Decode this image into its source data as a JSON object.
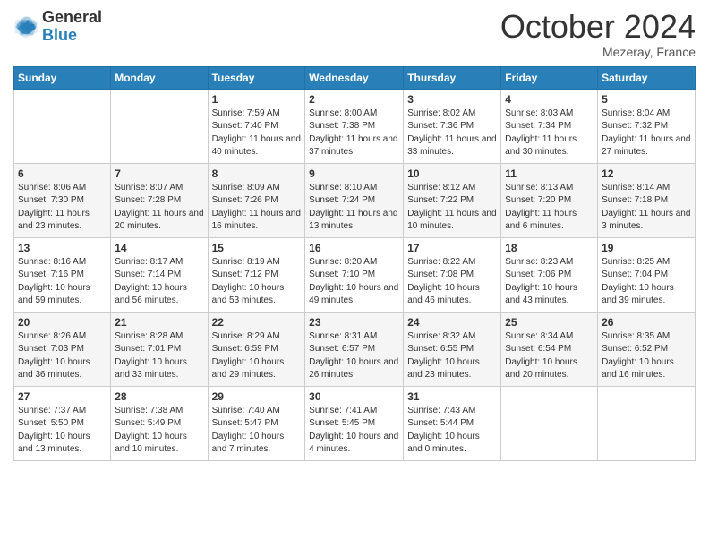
{
  "header": {
    "logo_general": "General",
    "logo_blue": "Blue",
    "month": "October 2024",
    "location": "Mezeray, France"
  },
  "days_of_week": [
    "Sunday",
    "Monday",
    "Tuesday",
    "Wednesday",
    "Thursday",
    "Friday",
    "Saturday"
  ],
  "weeks": [
    [
      {
        "day": "",
        "info": ""
      },
      {
        "day": "",
        "info": ""
      },
      {
        "day": "1",
        "info": "Sunrise: 7:59 AM\nSunset: 7:40 PM\nDaylight: 11 hours and 40 minutes."
      },
      {
        "day": "2",
        "info": "Sunrise: 8:00 AM\nSunset: 7:38 PM\nDaylight: 11 hours and 37 minutes."
      },
      {
        "day": "3",
        "info": "Sunrise: 8:02 AM\nSunset: 7:36 PM\nDaylight: 11 hours and 33 minutes."
      },
      {
        "day": "4",
        "info": "Sunrise: 8:03 AM\nSunset: 7:34 PM\nDaylight: 11 hours and 30 minutes."
      },
      {
        "day": "5",
        "info": "Sunrise: 8:04 AM\nSunset: 7:32 PM\nDaylight: 11 hours and 27 minutes."
      }
    ],
    [
      {
        "day": "6",
        "info": "Sunrise: 8:06 AM\nSunset: 7:30 PM\nDaylight: 11 hours and 23 minutes."
      },
      {
        "day": "7",
        "info": "Sunrise: 8:07 AM\nSunset: 7:28 PM\nDaylight: 11 hours and 20 minutes."
      },
      {
        "day": "8",
        "info": "Sunrise: 8:09 AM\nSunset: 7:26 PM\nDaylight: 11 hours and 16 minutes."
      },
      {
        "day": "9",
        "info": "Sunrise: 8:10 AM\nSunset: 7:24 PM\nDaylight: 11 hours and 13 minutes."
      },
      {
        "day": "10",
        "info": "Sunrise: 8:12 AM\nSunset: 7:22 PM\nDaylight: 11 hours and 10 minutes."
      },
      {
        "day": "11",
        "info": "Sunrise: 8:13 AM\nSunset: 7:20 PM\nDaylight: 11 hours and 6 minutes."
      },
      {
        "day": "12",
        "info": "Sunrise: 8:14 AM\nSunset: 7:18 PM\nDaylight: 11 hours and 3 minutes."
      }
    ],
    [
      {
        "day": "13",
        "info": "Sunrise: 8:16 AM\nSunset: 7:16 PM\nDaylight: 10 hours and 59 minutes."
      },
      {
        "day": "14",
        "info": "Sunrise: 8:17 AM\nSunset: 7:14 PM\nDaylight: 10 hours and 56 minutes."
      },
      {
        "day": "15",
        "info": "Sunrise: 8:19 AM\nSunset: 7:12 PM\nDaylight: 10 hours and 53 minutes."
      },
      {
        "day": "16",
        "info": "Sunrise: 8:20 AM\nSunset: 7:10 PM\nDaylight: 10 hours and 49 minutes."
      },
      {
        "day": "17",
        "info": "Sunrise: 8:22 AM\nSunset: 7:08 PM\nDaylight: 10 hours and 46 minutes."
      },
      {
        "day": "18",
        "info": "Sunrise: 8:23 AM\nSunset: 7:06 PM\nDaylight: 10 hours and 43 minutes."
      },
      {
        "day": "19",
        "info": "Sunrise: 8:25 AM\nSunset: 7:04 PM\nDaylight: 10 hours and 39 minutes."
      }
    ],
    [
      {
        "day": "20",
        "info": "Sunrise: 8:26 AM\nSunset: 7:03 PM\nDaylight: 10 hours and 36 minutes."
      },
      {
        "day": "21",
        "info": "Sunrise: 8:28 AM\nSunset: 7:01 PM\nDaylight: 10 hours and 33 minutes."
      },
      {
        "day": "22",
        "info": "Sunrise: 8:29 AM\nSunset: 6:59 PM\nDaylight: 10 hours and 29 minutes."
      },
      {
        "day": "23",
        "info": "Sunrise: 8:31 AM\nSunset: 6:57 PM\nDaylight: 10 hours and 26 minutes."
      },
      {
        "day": "24",
        "info": "Sunrise: 8:32 AM\nSunset: 6:55 PM\nDaylight: 10 hours and 23 minutes."
      },
      {
        "day": "25",
        "info": "Sunrise: 8:34 AM\nSunset: 6:54 PM\nDaylight: 10 hours and 20 minutes."
      },
      {
        "day": "26",
        "info": "Sunrise: 8:35 AM\nSunset: 6:52 PM\nDaylight: 10 hours and 16 minutes."
      }
    ],
    [
      {
        "day": "27",
        "info": "Sunrise: 7:37 AM\nSunset: 5:50 PM\nDaylight: 10 hours and 13 minutes."
      },
      {
        "day": "28",
        "info": "Sunrise: 7:38 AM\nSunset: 5:49 PM\nDaylight: 10 hours and 10 minutes."
      },
      {
        "day": "29",
        "info": "Sunrise: 7:40 AM\nSunset: 5:47 PM\nDaylight: 10 hours and 7 minutes."
      },
      {
        "day": "30",
        "info": "Sunrise: 7:41 AM\nSunset: 5:45 PM\nDaylight: 10 hours and 4 minutes."
      },
      {
        "day": "31",
        "info": "Sunrise: 7:43 AM\nSunset: 5:44 PM\nDaylight: 10 hours and 0 minutes."
      },
      {
        "day": "",
        "info": ""
      },
      {
        "day": "",
        "info": ""
      }
    ]
  ]
}
